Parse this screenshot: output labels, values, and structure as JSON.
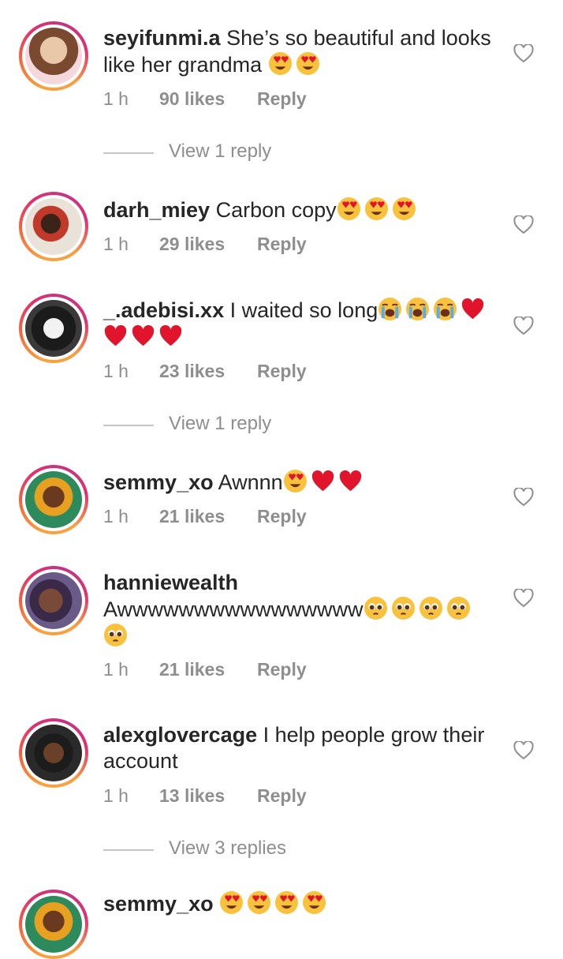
{
  "comments": [
    {
      "username": "seyifunmi.a",
      "text": "She’s so beautiful and looks like her grandma 😍😍",
      "time": "1 h",
      "likes": "90 likes",
      "reply_label": "Reply",
      "view_replies": "View 1 reply"
    },
    {
      "username": "darh_miey",
      "text": "Carbon copy😍😍😍",
      "time": "1 h",
      "likes": "29 likes",
      "reply_label": "Reply"
    },
    {
      "username": "_.adebisi.xx",
      "text": "I waited so long😭😭😭❤️❤️❤️❤️",
      "time": "1 h",
      "likes": "23 likes",
      "reply_label": "Reply",
      "view_replies": "View 1 reply"
    },
    {
      "username": "semmy_xo",
      "text": "Awnnn😍❤️❤️",
      "time": "1 h",
      "likes": "21 likes",
      "reply_label": "Reply"
    },
    {
      "username": "hanniewealth",
      "text": "Awwwwwwwwwwwwwwww🥺🥺🥺🥺🥺",
      "time": "1 h",
      "likes": "21 likes",
      "reply_label": "Reply"
    },
    {
      "username": "alexglovercage",
      "text": "I help people grow their account",
      "time": "1 h",
      "likes": "13 likes",
      "reply_label": "Reply",
      "view_replies": "View 3 replies"
    },
    {
      "username": "semmy_xo",
      "text": "😍😍😍😍"
    }
  ],
  "colors": {
    "text": "#262626",
    "muted": "#8e8e8e",
    "divider": "#c7c7c7",
    "heart_red": "#e0152b",
    "emoji_yellow": "#f9c23c"
  },
  "icons": {
    "like": "heart-outline-icon"
  }
}
